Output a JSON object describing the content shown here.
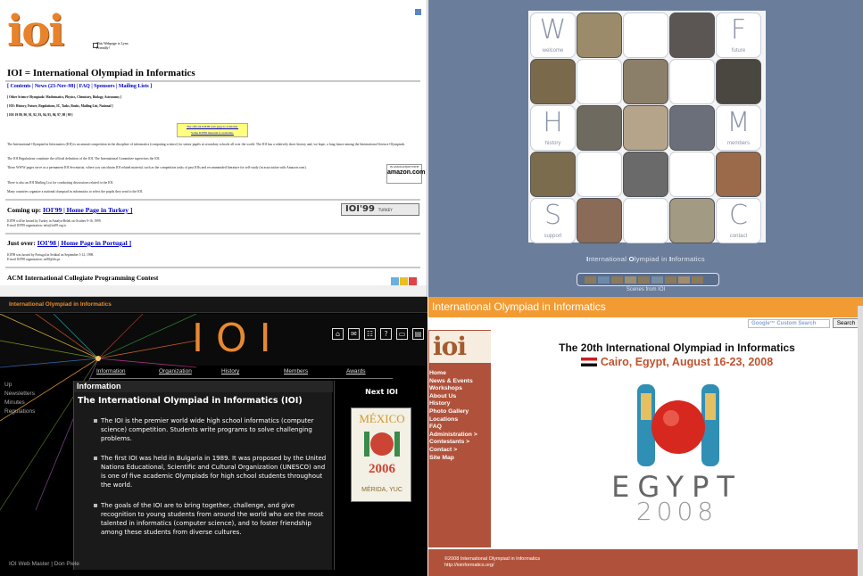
{
  "q1": {
    "logo": "ioi",
    "lynx": "This Webpage is Lynx Friendly!",
    "title": "IOI = International Olympiad in Informatics",
    "nav": [
      "[ Contents",
      "| News (23-Nov-98)",
      "| FAQ",
      "| Sponsors",
      "| Mailing Lists ]"
    ],
    "line_other": "[ Other Science Olympiads: Mathematics, Physics, Chemistry, Biology, Astronomy ]",
    "line_ioi": "[ IOI: History, Future, Regulations, IC, Tasks, Books, Mailing List, National ]",
    "line_years": "[ IOI 19 89, 90, 91, 92, 93, 94, 95, 96, 97, 98 | 99 ]",
    "notice1": "The official IOI'99 web page is available.",
    "notice2": "Some IOI'98 material is available.",
    "p1": "The International Olympiad in Informatics (IOI) is an annual competition in the discipline of informatics (computing science) for senior pupils at secondary schools all over the world. The IOI has a relatively short history and, we hope, a long future among the International Science Olympiads.",
    "p2": "The IOI Regulations constitute the official definition of the IOI. The International Committee supervises the IOI.",
    "p3": "These WWW pages serve as a permanent IOI Secretariat, where you can obtain IOI related material, such as the competition tasks of past IOIs and recommended literature for self-study (in association with Amazon.com).",
    "p4": "There is also an IOI Mailing List for conducting discussions related to the IOI.",
    "p5": "Many countries organize a national olympiad in informatics to select the pupils they send to the IOI.",
    "amazon_top": "IN ASSOCIATION WITH",
    "amazon": "amazon.com",
    "coming_label": "Coming up:",
    "coming_links": "IOI'99 | Home Page in Turkey ]",
    "coming_text1": "IOI'99 will be hosted by Turkey in Antalya-Belek on October 9-16, 1999.",
    "coming_text2": "E-mail IOI'99 organization: info@ioi99.org.tr.",
    "ioi99": "IOI'99",
    "turkey": "TURKEY",
    "justover_label": "Just over:",
    "justover_links": "IOI'98 | Home Page in Portugal ]",
    "justover_text1": "IOI'98 was hosted by Portugal in Setúbal on September 5-12, 1998.",
    "justover_text2": "E-mail IOI'98 organization: ioi98@dsi.pt.",
    "acm": "ACM International Collegiate Programming Contest"
  },
  "q2": {
    "tiles": [
      {
        "letter": "W",
        "label": "welcome"
      },
      {
        "letter": "F",
        "label": "future"
      },
      {
        "letter": "H",
        "label": "history"
      },
      {
        "letter": "M",
        "label": "members"
      },
      {
        "letter": "S",
        "label": "support"
      },
      {
        "letter": "C",
        "label": "contact"
      }
    ],
    "caption_parts": [
      "I",
      "nternational ",
      "O",
      "lympiad in ",
      "I",
      "nformatics"
    ],
    "scenes": "Scenes from IOI"
  },
  "q3": {
    "topbar": "International Olympiad in Informatics",
    "banner": "IOI",
    "icons": [
      "home-icon",
      "mail-icon",
      "sitemap-icon",
      "help-icon",
      "window-icon",
      "print-icon"
    ],
    "menu": [
      "Information",
      "Organization",
      "History",
      "Members",
      "Awards"
    ],
    "side": [
      "Up",
      "Newsletters",
      "Minutes",
      "Regulations"
    ],
    "section": "Information",
    "heading": "The International Olympiad in Informatics (IOI)",
    "bullets": [
      "The IOI is the premier world wide high school informatics (computer science) competition. Students write programs to solve challenging problems.",
      "The first IOI was held in Bulgaria in 1989.  It was proposed by the United Nations Educational, Scientific and Cultural Organization (UNESCO) and is one of five academic Olympiads for high school students throughout the world.",
      "The goals of the IOI are to bring together, challenge, and give recognition to young students from around the world who are the most talented in informatics (computer science), and to foster friendship among these students from diverse cultures."
    ],
    "next": "Next IOI",
    "poster_country": "MÉXICO",
    "poster_year": "2006",
    "poster_city": "MÉRIDA, YUC",
    "footer": "IOI  Web Master  |  Don Piele"
  },
  "q4": {
    "header": "International Olympiad in Informatics",
    "search_placeholder": "Google™ Custom Search",
    "search_button": "Search",
    "logo": "ioi",
    "nav": [
      "Home",
      "News & Events",
      "Workshops",
      "About Us",
      "History",
      "Photo Gallery",
      "Locations",
      "FAQ",
      "Administration >",
      "Contestants >",
      "Contact >",
      "Site Map"
    ],
    "title": "The 20th International Olympiad in Informatics",
    "subtitle": "Cairo, Egypt, August 16-23, 2008",
    "egypt": "EGYPT",
    "year": "2008",
    "footer1": "©2008 International Olympiad in Informatics",
    "footer2": "http://ioinformatics.org/"
  }
}
